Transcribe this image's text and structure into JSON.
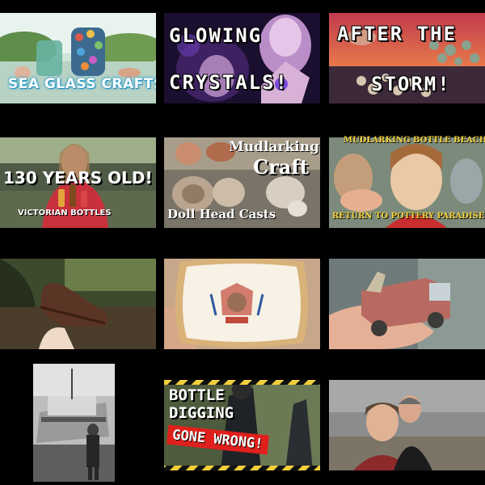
{
  "tiles": {
    "sea_glass": {
      "caption": "SEA GLASS CRAFTS!"
    },
    "crystals": {
      "line1": "GLOWING",
      "line2": "CRYSTALS!"
    },
    "storm": {
      "line1": "AFTER THE",
      "line2": "STORM!"
    },
    "victorian": {
      "line1": "130 YEARS OLD!",
      "line2": "VICTORIAN BOTTLES"
    },
    "mudlarking_craft": {
      "line1": "Mudlarking",
      "line2": "Craft",
      "line3": "Doll Head Casts"
    },
    "bottle_beach": {
      "line1": "MUDLARKING BOTTLE BEACH",
      "line2": "RETURN TO POTTERY PARADISE"
    },
    "shoe": {},
    "souvenir_dish": {},
    "toy_truck": {},
    "ferry_photo": {},
    "bottle_digging": {
      "line1": "BOTTLE",
      "line2": "DIGGING",
      "line3": "GONE WRONG!"
    },
    "two_men": {}
  },
  "colors": {
    "background": "#000000",
    "caption_white": "#ffffff",
    "caption_yellow": "#f2d03b",
    "danger_red": "#e0201c"
  }
}
